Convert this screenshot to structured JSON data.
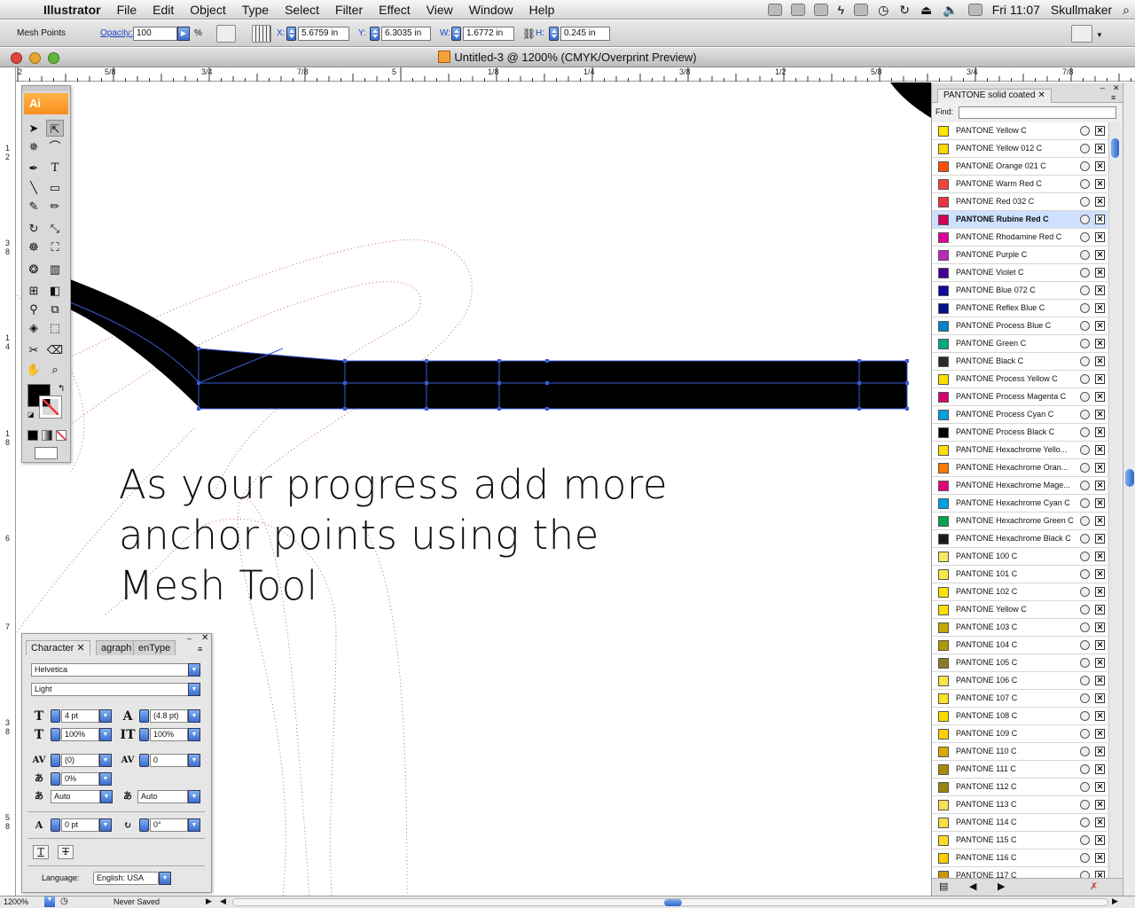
{
  "menubar": {
    "app_name": "Illustrator",
    "items": [
      "File",
      "Edit",
      "Object",
      "Type",
      "Select",
      "Filter",
      "Effect",
      "View",
      "Window",
      "Help"
    ],
    "clock": "Fri 11:07",
    "user": "Skullmaker"
  },
  "controlbar": {
    "mode_label": "Mesh Points",
    "opacity_label": "Opacity:",
    "opacity_value": "100",
    "opacity_unit": "%",
    "x_label": "X:",
    "x_value": "5.6759 in",
    "y_label": "Y:",
    "y_value": "6.3035 in",
    "w_label": "W:",
    "w_value": "1.6772 in",
    "h_label": "H:",
    "h_value": "0.245 in"
  },
  "document": {
    "title": "Untitled-3 @ 1200% (CMYK/Overprint Preview)"
  },
  "ruler": {
    "h_ticks": [
      "2",
      "5/8",
      "3/4",
      "7/8",
      "5",
      "1/8",
      "3/8",
      "1/4",
      "1/2",
      "5/8",
      "3/4",
      "7/8"
    ],
    "v_ticks": [
      "1",
      "2",
      "3",
      "8",
      "1",
      "4",
      "1",
      "8",
      "6",
      "7",
      "3",
      "8",
      "5",
      "8"
    ]
  },
  "canvas": {
    "caption": "As your progress add more\nanchor points using the\nMesh Tool"
  },
  "toolbox": {
    "logo": "Ai"
  },
  "character_panel": {
    "tabs": [
      "Character",
      "agraph",
      "enType"
    ],
    "font_family": "Helvetica",
    "font_style": "Light",
    "font_size": "4 pt",
    "leading": "(4.8 pt)",
    "horizontal_scale": "100%",
    "vertical_scale": "100%",
    "kerning": "(0)",
    "tracking": "0",
    "tsume": "0%",
    "aki_left": "Auto",
    "aki_right": "Auto",
    "baseline_shift": "0 pt",
    "rotation": "0°",
    "language_label": "Language:",
    "language_value": "English: USA"
  },
  "swatch_panel": {
    "tab_title": "PANTONE solid coated",
    "find_label": "Find:",
    "swatches": [
      {
        "name": "PANTONE Yellow C",
        "color": "#FFE500"
      },
      {
        "name": "PANTONE Yellow 012 C",
        "color": "#FFD700"
      },
      {
        "name": "PANTONE Orange 021 C",
        "color": "#FE5000"
      },
      {
        "name": "PANTONE Warm Red C",
        "color": "#F9423A"
      },
      {
        "name": "PANTONE Red 032 C",
        "color": "#EF3340"
      },
      {
        "name": "PANTONE Rubine Red C",
        "color": "#CE0058"
      },
      {
        "name": "PANTONE Rhodamine Red C",
        "color": "#E10098"
      },
      {
        "name": "PANTONE Purple C",
        "color": "#BB29BB"
      },
      {
        "name": "PANTONE Violet C",
        "color": "#440099"
      },
      {
        "name": "PANTONE Blue 072 C",
        "color": "#10069F"
      },
      {
        "name": "PANTONE Reflex Blue C",
        "color": "#001489"
      },
      {
        "name": "PANTONE Process Blue C",
        "color": "#0085CA"
      },
      {
        "name": "PANTONE Green C",
        "color": "#00AB84"
      },
      {
        "name": "PANTONE Black C",
        "color": "#2D2926"
      },
      {
        "name": "PANTONE Process Yellow C",
        "color": "#FEDD00"
      },
      {
        "name": "PANTONE Process Magenta C",
        "color": "#D7006D"
      },
      {
        "name": "PANTONE Process Cyan C",
        "color": "#009FDF"
      },
      {
        "name": "PANTONE Process Black C",
        "color": "#000000"
      },
      {
        "name": "PANTONE Hexachrome Yello...",
        "color": "#FFE100"
      },
      {
        "name": "PANTONE Hexachrome Oran...",
        "color": "#FF7900"
      },
      {
        "name": "PANTONE Hexachrome Mage...",
        "color": "#E4007C"
      },
      {
        "name": "PANTONE Hexachrome Cyan C",
        "color": "#00A0E2"
      },
      {
        "name": "PANTONE Hexachrome Green C",
        "color": "#00A550"
      },
      {
        "name": "PANTONE Hexachrome Black C",
        "color": "#1A1A1A"
      },
      {
        "name": "PANTONE 100 C",
        "color": "#F6EB61"
      },
      {
        "name": "PANTONE 101 C",
        "color": "#F7EA48"
      },
      {
        "name": "PANTONE 102 C",
        "color": "#FCE300"
      },
      {
        "name": "PANTONE Yellow C",
        "color": "#FEDD00"
      },
      {
        "name": "PANTONE 103 C",
        "color": "#C5A900"
      },
      {
        "name": "PANTONE 104 C",
        "color": "#AF9800"
      },
      {
        "name": "PANTONE 105 C",
        "color": "#897A27"
      },
      {
        "name": "PANTONE 106 C",
        "color": "#F9E547"
      },
      {
        "name": "PANTONE 107 C",
        "color": "#FBE122"
      },
      {
        "name": "PANTONE 108 C",
        "color": "#FEDB00"
      },
      {
        "name": "PANTONE 109 C",
        "color": "#FFD100"
      },
      {
        "name": "PANTONE 110 C",
        "color": "#DAAA00"
      },
      {
        "name": "PANTONE 111 C",
        "color": "#AA8A00"
      },
      {
        "name": "PANTONE 112 C",
        "color": "#9C8412"
      },
      {
        "name": "PANTONE 113 C",
        "color": "#FAE053"
      },
      {
        "name": "PANTONE 114 C",
        "color": "#FBDD40"
      },
      {
        "name": "PANTONE 115 C",
        "color": "#FDDA24"
      },
      {
        "name": "PANTONE 116 C",
        "color": "#FFCD00"
      },
      {
        "name": "PANTONE 117 C",
        "color": "#C99700"
      }
    ],
    "selected_index": 5
  },
  "statusbar": {
    "zoom": "1200%",
    "save_state": "Never Saved"
  }
}
